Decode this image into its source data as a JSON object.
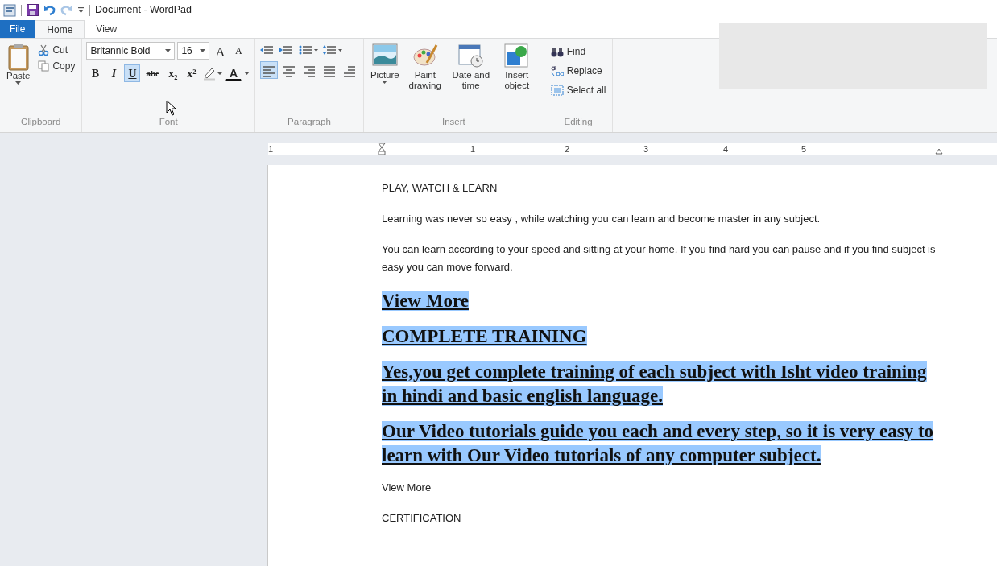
{
  "window": {
    "title": "Document - WordPad"
  },
  "tabs": [
    {
      "label": "File",
      "kind": "file",
      "selected": false
    },
    {
      "label": "Home",
      "kind": "tab",
      "selected": true
    },
    {
      "label": "View",
      "kind": "tab",
      "selected": false
    }
  ],
  "ribbon": {
    "clipboard": {
      "label": "Clipboard",
      "paste": "Paste",
      "cut": "Cut",
      "copy": "Copy"
    },
    "font": {
      "label": "Font",
      "font_name": "Britannic Bold",
      "font_size": "16",
      "grow_glyph": "A",
      "shrink_glyph": "A",
      "color_glyph": "A",
      "styles": [
        {
          "glyph": "B",
          "kind": "bold",
          "on": false
        },
        {
          "glyph": "I",
          "kind": "italic",
          "on": false
        },
        {
          "glyph": "U",
          "kind": "underline",
          "on": true
        },
        {
          "glyph": "abc",
          "kind": "strike",
          "on": false
        },
        {
          "glyph": "x₂",
          "kind": "plain",
          "on": false
        },
        {
          "glyph": "x²",
          "kind": "plain",
          "on": false
        }
      ]
    },
    "paragraph": {
      "label": "Paragraph",
      "alignments": [
        {
          "kind": "left",
          "on": true
        },
        {
          "kind": "center",
          "on": false
        },
        {
          "kind": "right",
          "on": false
        },
        {
          "kind": "justify",
          "on": false
        },
        {
          "kind": "rtl",
          "on": false
        }
      ]
    },
    "insert": {
      "label": "Insert",
      "buttons": [
        {
          "label": "Picture",
          "kind": "picture",
          "dropdown": true
        },
        {
          "label": "Paint drawing",
          "kind": "paint",
          "dropdown": false
        },
        {
          "label": "Date and time",
          "kind": "calendar",
          "dropdown": false
        },
        {
          "label": "Insert object",
          "kind": "object",
          "dropdown": false
        }
      ]
    },
    "editing": {
      "label": "Editing",
      "buttons": [
        {
          "label": "Find",
          "kind": "find"
        },
        {
          "label": "Replace",
          "kind": "replace"
        },
        {
          "label": "Select all",
          "kind": "selectall"
        }
      ]
    }
  },
  "ruler": {
    "labels": [
      "1",
      "1",
      "2",
      "3",
      "4",
      "5"
    ]
  },
  "document": {
    "paragraphs": [
      {
        "text": "PLAY, WATCH & LEARN",
        "kind": "plain",
        "selected": false
      },
      {
        "text": "Learning was never so easy , while watching you can learn and become master in any subject.",
        "kind": "plain",
        "selected": false
      },
      {
        "text": "You can learn according to your speed and sitting at your home. If you find hard you can pause and if you find subject is easy you can move forward.",
        "kind": "plain",
        "selected": false
      },
      {
        "text": "View More",
        "kind": "heading",
        "selected": true
      },
      {
        "text": "COMPLETE TRAINING",
        "kind": "heading",
        "selected": true
      },
      {
        "text": "Yes,you get complete training of each subject with Isht video training in hindi and basic english language.",
        "kind": "heading",
        "selected": true
      },
      {
        "text": "Our Video tutorials guide you each and every step, so it is very easy to learn with Our Video tutorials of any computer subject.",
        "kind": "heading",
        "selected": true
      },
      {
        "text": "View More",
        "kind": "plain",
        "selected": false
      },
      {
        "text": "CERTIFICATION",
        "kind": "plain",
        "selected": false
      }
    ]
  }
}
